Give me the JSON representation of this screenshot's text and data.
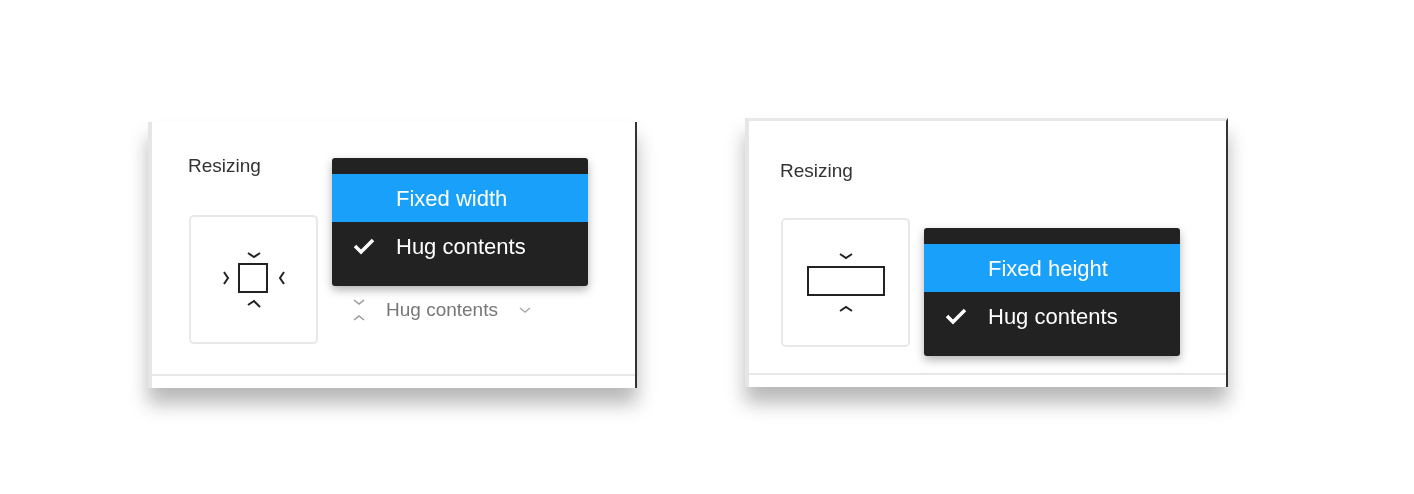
{
  "panels": [
    {
      "title": "Resizing",
      "preview": {
        "kind": "both"
      },
      "menu": {
        "items": [
          {
            "label": "Fixed width",
            "highlighted": true,
            "checked": false
          },
          {
            "label": "Hug contents",
            "highlighted": false,
            "checked": true
          }
        ]
      },
      "dropdown": {
        "value": "Hug contents"
      }
    },
    {
      "title": "Resizing",
      "preview": {
        "kind": "height"
      },
      "menu": {
        "items": [
          {
            "label": "Fixed height",
            "highlighted": true,
            "checked": false
          },
          {
            "label": "Hug contents",
            "highlighted": false,
            "checked": true
          }
        ]
      }
    }
  ]
}
